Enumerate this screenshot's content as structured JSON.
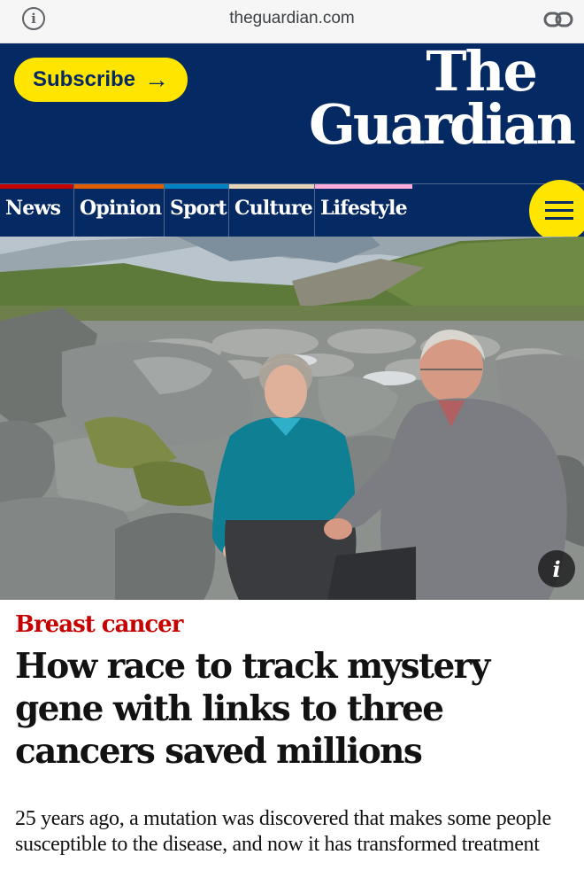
{
  "browser": {
    "url": "theguardian.com",
    "left_icon": "info-icon",
    "right_icon": "link-icon"
  },
  "masthead": {
    "subscribe_label": "Subscribe",
    "subscribe_arrow": "→",
    "logo_line1": "The",
    "logo_line2": "Guardian",
    "background_color": "#052962",
    "button_color": "#ffe500"
  },
  "nav": {
    "items": [
      {
        "label": "News",
        "color": "#c70000"
      },
      {
        "label": "Opinion",
        "color": "#e05e00"
      },
      {
        "label": "Sport",
        "color": "#0084c6"
      },
      {
        "label": "Culture",
        "color": "#a1845c"
      },
      {
        "label": "Lifestyle",
        "color": "#bb3b80"
      }
    ],
    "menu_icon": "hamburger-menu-icon"
  },
  "hero": {
    "info_label": "i",
    "info_icon": "info-icon"
  },
  "article": {
    "kicker": "Breast cancer",
    "headline": "How race to track mystery gene with links to three cancers saved millions",
    "standfirst": "25 years ago, a mutation was discovered that makes some people susceptible to the disease, and now it has transformed treatment",
    "kicker_color": "#c70000"
  }
}
